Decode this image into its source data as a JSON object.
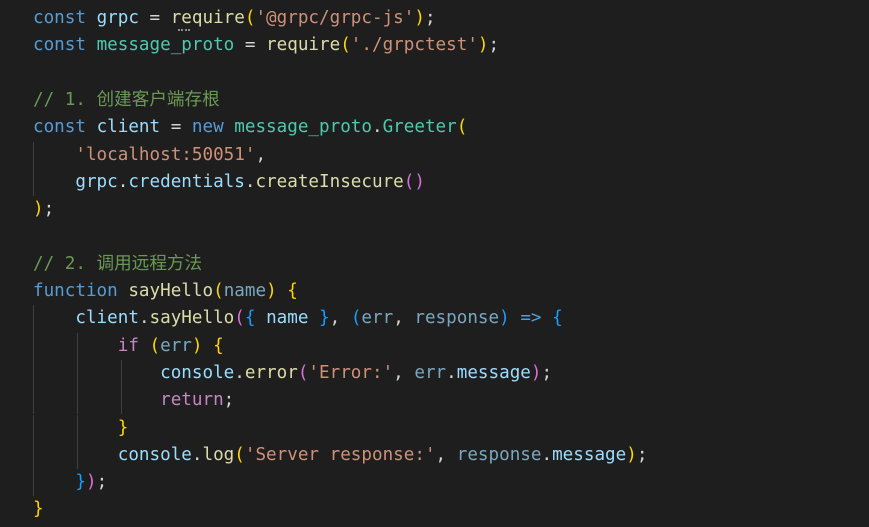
{
  "editor": {
    "lines": [
      [
        {
          "t": "const",
          "c": "kw"
        },
        {
          "t": " ",
          "c": "p"
        },
        {
          "t": "grpc",
          "c": "var"
        },
        {
          "t": " = ",
          "c": "p"
        },
        {
          "t": "require",
          "c": "fn"
        },
        {
          "t": "(",
          "c": "b1"
        },
        {
          "t": "'@grpc/grpc-js'",
          "c": "str"
        },
        {
          "t": ")",
          "c": "b1"
        },
        {
          "t": ";",
          "c": "p"
        }
      ],
      [
        {
          "t": "const",
          "c": "kw"
        },
        {
          "t": " ",
          "c": "p"
        },
        {
          "t": "message_proto",
          "c": "cls"
        },
        {
          "t": " = ",
          "c": "p"
        },
        {
          "t": "require",
          "c": "fn"
        },
        {
          "t": "(",
          "c": "b1"
        },
        {
          "t": "'./grpctest'",
          "c": "str"
        },
        {
          "t": ")",
          "c": "b1"
        },
        {
          "t": ";",
          "c": "p"
        }
      ],
      [],
      [
        {
          "t": "// 1. 创建客户端存根",
          "c": "cmt"
        }
      ],
      [
        {
          "t": "const",
          "c": "kw"
        },
        {
          "t": " ",
          "c": "p"
        },
        {
          "t": "client",
          "c": "var"
        },
        {
          "t": " = ",
          "c": "p"
        },
        {
          "t": "new",
          "c": "kw"
        },
        {
          "t": " ",
          "c": "p"
        },
        {
          "t": "message_proto",
          "c": "cls"
        },
        {
          "t": ".",
          "c": "p"
        },
        {
          "t": "Greeter",
          "c": "cls"
        },
        {
          "t": "(",
          "c": "b1"
        }
      ],
      [
        {
          "t": "    ",
          "c": "p"
        },
        {
          "t": "'localhost:50051'",
          "c": "str"
        },
        {
          "t": ",",
          "c": "p"
        }
      ],
      [
        {
          "t": "    ",
          "c": "p"
        },
        {
          "t": "grpc",
          "c": "var"
        },
        {
          "t": ".",
          "c": "p"
        },
        {
          "t": "credentials",
          "c": "var"
        },
        {
          "t": ".",
          "c": "p"
        },
        {
          "t": "createInsecure",
          "c": "fn"
        },
        {
          "t": "()",
          "c": "b2"
        }
      ],
      [
        {
          "t": ")",
          "c": "b1"
        },
        {
          "t": ";",
          "c": "p"
        }
      ],
      [],
      [
        {
          "t": "// 2. 调用远程方法",
          "c": "cmt"
        }
      ],
      [
        {
          "t": "function",
          "c": "kw"
        },
        {
          "t": " ",
          "c": "p"
        },
        {
          "t": "sayHello",
          "c": "fn"
        },
        {
          "t": "(",
          "c": "b1"
        },
        {
          "t": "name",
          "c": "par"
        },
        {
          "t": ")",
          "c": "b1"
        },
        {
          "t": " ",
          "c": "p"
        },
        {
          "t": "{",
          "c": "b1"
        }
      ],
      [
        {
          "t": "    ",
          "c": "p"
        },
        {
          "t": "client",
          "c": "var"
        },
        {
          "t": ".",
          "c": "p"
        },
        {
          "t": "sayHello",
          "c": "fn"
        },
        {
          "t": "(",
          "c": "b2"
        },
        {
          "t": "{",
          "c": "b3"
        },
        {
          "t": " ",
          "c": "p"
        },
        {
          "t": "name",
          "c": "var"
        },
        {
          "t": " ",
          "c": "p"
        },
        {
          "t": "}",
          "c": "b3"
        },
        {
          "t": ", ",
          "c": "p"
        },
        {
          "t": "(",
          "c": "b3"
        },
        {
          "t": "err",
          "c": "par"
        },
        {
          "t": ", ",
          "c": "p"
        },
        {
          "t": "response",
          "c": "par"
        },
        {
          "t": ")",
          "c": "b3"
        },
        {
          "t": " ",
          "c": "p"
        },
        {
          "t": "=>",
          "c": "kw"
        },
        {
          "t": " ",
          "c": "p"
        },
        {
          "t": "{",
          "c": "b3"
        }
      ],
      [
        {
          "t": "        ",
          "c": "p"
        },
        {
          "t": "if",
          "c": "ctl"
        },
        {
          "t": " ",
          "c": "p"
        },
        {
          "t": "(",
          "c": "b1"
        },
        {
          "t": "err",
          "c": "par"
        },
        {
          "t": ")",
          "c": "b1"
        },
        {
          "t": " ",
          "c": "p"
        },
        {
          "t": "{",
          "c": "b1"
        }
      ],
      [
        {
          "t": "            ",
          "c": "p"
        },
        {
          "t": "console",
          "c": "var"
        },
        {
          "t": ".",
          "c": "p"
        },
        {
          "t": "error",
          "c": "fn"
        },
        {
          "t": "(",
          "c": "b2"
        },
        {
          "t": "'Error:'",
          "c": "str"
        },
        {
          "t": ", ",
          "c": "p"
        },
        {
          "t": "err",
          "c": "par"
        },
        {
          "t": ".",
          "c": "p"
        },
        {
          "t": "message",
          "c": "var"
        },
        {
          "t": ")",
          "c": "b2"
        },
        {
          "t": ";",
          "c": "p"
        }
      ],
      [
        {
          "t": "            ",
          "c": "p"
        },
        {
          "t": "return",
          "c": "ctl"
        },
        {
          "t": ";",
          "c": "p"
        }
      ],
      [
        {
          "t": "        ",
          "c": "p"
        },
        {
          "t": "}",
          "c": "b1"
        }
      ],
      [
        {
          "t": "        ",
          "c": "p"
        },
        {
          "t": "console",
          "c": "var"
        },
        {
          "t": ".",
          "c": "p"
        },
        {
          "t": "log",
          "c": "fn"
        },
        {
          "t": "(",
          "c": "b1"
        },
        {
          "t": "'Server response:'",
          "c": "str"
        },
        {
          "t": ", ",
          "c": "p"
        },
        {
          "t": "response",
          "c": "par"
        },
        {
          "t": ".",
          "c": "p"
        },
        {
          "t": "message",
          "c": "var"
        },
        {
          "t": ")",
          "c": "b1"
        },
        {
          "t": ";",
          "c": "p"
        }
      ],
      [
        {
          "t": "    ",
          "c": "p"
        },
        {
          "t": "}",
          "c": "b3"
        },
        {
          "t": ")",
          "c": "b2"
        },
        {
          "t": ";",
          "c": "p"
        }
      ],
      [
        {
          "t": "}",
          "c": "b1"
        }
      ]
    ]
  }
}
